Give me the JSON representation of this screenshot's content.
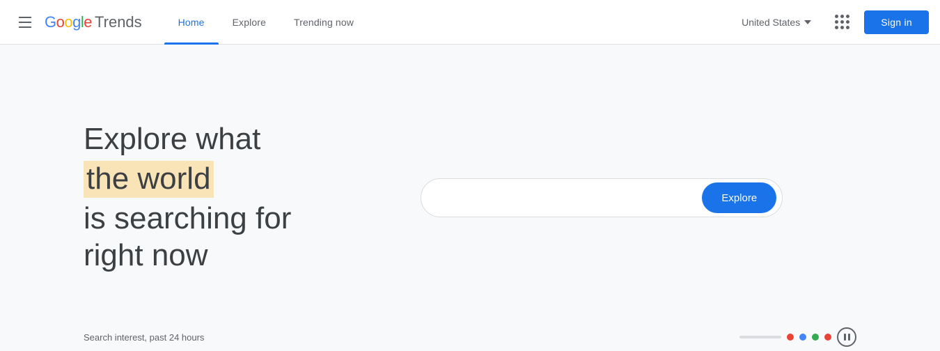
{
  "header": {
    "menu_label": "Menu",
    "logo_google": "Google",
    "logo_trends": "Trends",
    "nav": [
      {
        "label": "Home",
        "active": true
      },
      {
        "label": "Explore",
        "active": false
      },
      {
        "label": "Trending now",
        "active": false
      }
    ],
    "country": "United States",
    "apps_label": "Google apps",
    "signin_label": "Sign in"
  },
  "main": {
    "hero": {
      "line1": "Explore what",
      "line2": "the world",
      "line3": "is searching for",
      "line4": "right now"
    },
    "search": {
      "placeholder": "",
      "explore_button": "Explore"
    }
  },
  "footer": {
    "search_interest_text": "Search interest, past 24 hours",
    "dots": [
      {
        "color": "#ea4335"
      },
      {
        "color": "#4285f4"
      },
      {
        "color": "#34a853"
      },
      {
        "color": "#ea4335"
      }
    ]
  }
}
